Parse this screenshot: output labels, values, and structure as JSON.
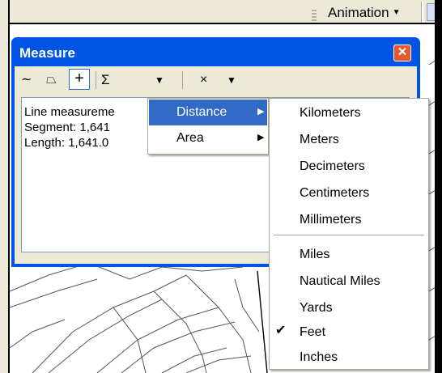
{
  "toolbar": {
    "animation_label": "Animation",
    "animation_arrow": "▼"
  },
  "window": {
    "title": "Measure",
    "close_symbol": "✕",
    "tools": {
      "measure_line_icon": "∼",
      "measure_area_icon": "⏢",
      "measure_feature_icon": "+",
      "sum_icon": "Σ",
      "sum_dropdown": "▼",
      "clear_icon": "×",
      "clear_dropdown": "▼"
    },
    "results": [
      "Line measureme",
      "Segment: 1,641",
      "Length: 1,641.0"
    ]
  },
  "menu": {
    "items": [
      {
        "label": "Distance",
        "arrow": "▶",
        "highlighted": true
      },
      {
        "label": "Area",
        "arrow": "▶",
        "highlighted": false
      }
    ]
  },
  "submenu": {
    "metric": [
      "Kilometers",
      "Meters",
      "Decimeters",
      "Centimeters",
      "Millimeters"
    ],
    "imperial": [
      "Miles",
      "Nautical Miles",
      "Yards",
      "Feet",
      "Inches"
    ],
    "checked_item": "Feet",
    "check_symbol": "✔"
  },
  "colors": {
    "title_bar": "#0054e3",
    "highlight": "#316ac5",
    "window_face": "#ece9d8"
  }
}
